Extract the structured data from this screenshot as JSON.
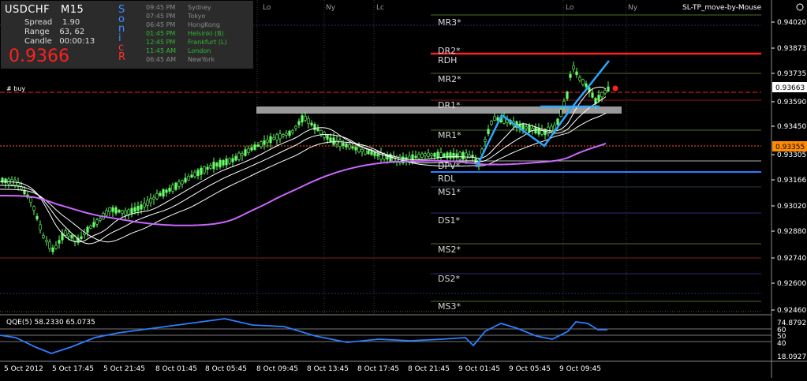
{
  "symbol_panel": {
    "symbol": "USDCHF",
    "timeframe": "M15",
    "spread_label": "Spread",
    "spread_value": "1.90",
    "range_label": "Range",
    "range_value": "63, 62",
    "candle_label": "Candle",
    "candle_value": "00:00:13",
    "price": "0.9366",
    "vertical_word": [
      "S",
      "o",
      "n",
      "i",
      "c",
      "R"
    ],
    "vertical_colors": [
      "#3a8fff",
      "#3a8fff",
      "#3a8fff",
      "#3a8fff",
      "#ff3030",
      "#ff3030"
    ]
  },
  "sessions": [
    {
      "time": "09:45 PM",
      "city": "Sydney",
      "color": "#8a8a8a"
    },
    {
      "time": "07:45 PM",
      "city": "Tokyo",
      "color": "#8a8a8a"
    },
    {
      "time": "06:45 PM",
      "city": "HongKong",
      "color": "#8a8a8a"
    },
    {
      "time": "01:45 PM",
      "city": "Helsinki  (B)",
      "color": "#2fb82f"
    },
    {
      "time": "12:45 PM",
      "city": "Frankfurt  (L)",
      "color": "#2fb82f"
    },
    {
      "time": "11:45 AM",
      "city": "London",
      "color": "#2fb82f"
    },
    {
      "time": "06:45 AM",
      "city": "NewYork",
      "color": "#8a8a8a"
    }
  ],
  "session_markers": [
    "Lo",
    "Ny",
    "Lc",
    "Lo",
    "Ny"
  ],
  "ea_label": "SL-TP_move-by-Mouse",
  "trade_label": "#         buy",
  "pivot_labels": {
    "mr3": "MR3*",
    "dr2": "DR2*",
    "rdh": "RDH",
    "mr2": "MR2*",
    "dr1": "DR1*",
    "mr1": "MR1*",
    "dpv": "DPV*",
    "rdl": "RDL",
    "ms1": "MS1*",
    "ds1": "DS1*",
    "ms2": "MS2*",
    "ds2": "DS2*",
    "ms3": "MS3*"
  },
  "price_axis": [
    "0.94020",
    "0.93873",
    "0.93735",
    "0.93663",
    "0.93590",
    "0.93450",
    "0.93355",
    "0.93305",
    "0.93166",
    "0.93020",
    "0.92880",
    "0.92740",
    "0.92600",
    "0.92460"
  ],
  "price_tag_current": "0.93663",
  "price_tag_hline": "0.93355",
  "indicator": {
    "label": "QQE(5) 58.2330 65.0735",
    "axis": [
      "74.8792",
      "60",
      "50",
      "40",
      "18.0927"
    ]
  },
  "time_axis": [
    "5 Oct 2012",
    "5 Oct 17:45",
    "5 Oct 21:45",
    "8 Oct 01:45",
    "8 Oct 05:45",
    "8 Oct 09:45",
    "8 Oct 13:45",
    "8 Oct 17:45",
    "8 Oct 21:45",
    "9 Oct 01:45",
    "9 Oct 05:45",
    "9 Oct 09:45"
  ],
  "colors": {
    "candle": "#66ff66",
    "ma_white": "#ffffff",
    "ma_magenta": "#cc66ff",
    "trend": "#29a8ff",
    "resistance": "#ff2020",
    "support": "#2a7fff",
    "grey_zone": "#a0a0a0"
  }
}
